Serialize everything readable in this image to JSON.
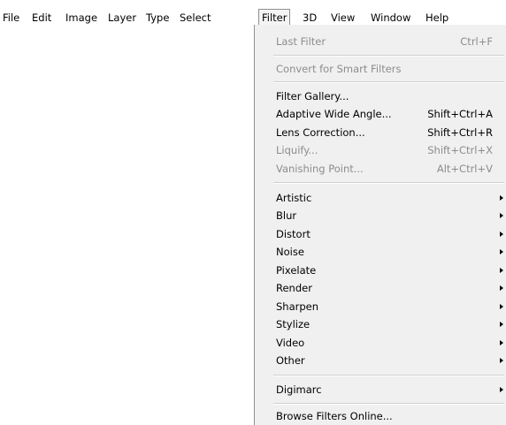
{
  "menubar": {
    "items": [
      {
        "label": "File"
      },
      {
        "label": "Edit"
      },
      {
        "label": "Image"
      },
      {
        "label": "Layer"
      },
      {
        "label": "Type"
      },
      {
        "label": "Select"
      },
      {
        "label": "Filter"
      },
      {
        "label": "3D"
      },
      {
        "label": "View"
      },
      {
        "label": "Window"
      },
      {
        "label": "Help"
      }
    ]
  },
  "filter_menu": {
    "last_filter": {
      "label": "Last Filter",
      "shortcut": "Ctrl+F"
    },
    "convert_smart": {
      "label": "Convert for Smart Filters"
    },
    "filter_gallery": {
      "label": "Filter Gallery..."
    },
    "adaptive_wide_angle": {
      "label": "Adaptive Wide Angle...",
      "shortcut": "Shift+Ctrl+A"
    },
    "lens_correction": {
      "label": "Lens Correction...",
      "shortcut": "Shift+Ctrl+R"
    },
    "liquify": {
      "label": "Liquify...",
      "shortcut": "Shift+Ctrl+X"
    },
    "vanishing_point": {
      "label": "Vanishing Point...",
      "shortcut": "Alt+Ctrl+V"
    },
    "submenus": [
      {
        "label": "Artistic"
      },
      {
        "label": "Blur"
      },
      {
        "label": "Distort"
      },
      {
        "label": "Noise"
      },
      {
        "label": "Pixelate"
      },
      {
        "label": "Render"
      },
      {
        "label": "Sharpen"
      },
      {
        "label": "Stylize"
      },
      {
        "label": "Video"
      },
      {
        "label": "Other"
      }
    ],
    "digimarc": {
      "label": "Digimarc"
    },
    "browse_online": {
      "label": "Browse Filters Online..."
    }
  },
  "colors": {
    "menu_background": "#f0f0f0",
    "disabled_text": "#8c8c8c",
    "border": "#8f8f8f"
  }
}
